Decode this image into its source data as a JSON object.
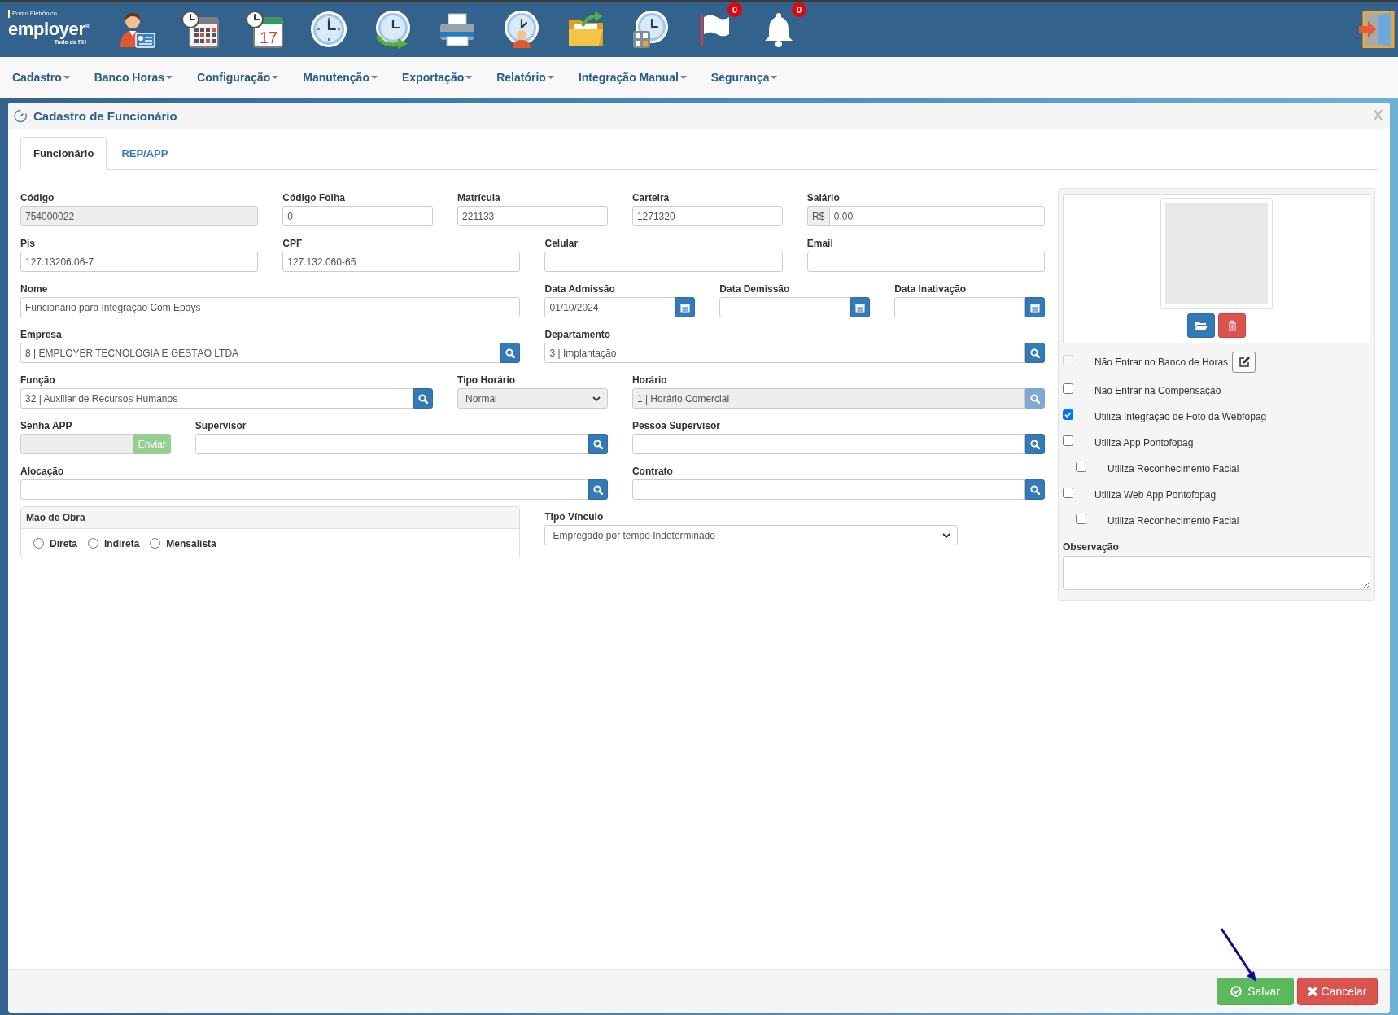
{
  "header": {
    "logo": {
      "tagline": "Ponto Eletrônico",
      "name": "employer$^{®}$",
      "slogan": "Tudo do RH"
    },
    "calendar_day": "17",
    "flag_badge": "0",
    "bell_badge": "0"
  },
  "menu": [
    "Cadastro",
    "Banco Horas",
    "Configuração",
    "Manutenção",
    "Exportação",
    "Relatório",
    "Integração Manual",
    "Segurança"
  ],
  "dialog": {
    "title": "Cadastro de Funcionário",
    "close": "X",
    "tabs": [
      {
        "label": "Funcionário",
        "selected": true
      },
      {
        "label": "REP/APP",
        "selected": false
      }
    ],
    "fields": [
      {
        "label": "Código",
        "kind": "text",
        "value": "754000022",
        "disabled": true
      },
      {
        "label": "Código Folha",
        "kind": "text",
        "value": "0",
        "disabled": false
      },
      {
        "label": "Matrícula",
        "kind": "text",
        "value": "221133",
        "disabled": false
      },
      {
        "label": "Carteira",
        "kind": "text",
        "value": "1271320",
        "disabled": false
      },
      {
        "label": "Salário",
        "kind": "money",
        "prefix": "R$",
        "value": "0,00",
        "disabled": false
      },
      {
        "label": "Pis",
        "kind": "text",
        "value": "127.13206.06-7",
        "disabled": false
      },
      {
        "label": "CPF",
        "kind": "text",
        "value": "127.132.060-65",
        "disabled": false
      },
      {
        "label": "Celular",
        "kind": "text",
        "disabled": false
      },
      {
        "label": "Email",
        "kind": "text",
        "disabled": false
      },
      {
        "label": "Nome",
        "kind": "text",
        "value": "Funcionário para Integração Com Epays",
        "disabled": false
      },
      {
        "label": "Data Admissão",
        "kind": "date",
        "value": "01/10/2024",
        "disabled": false
      },
      {
        "label": "Data Demissão",
        "kind": "date",
        "disabled": false
      },
      {
        "label": "Data Inativação",
        "kind": "date",
        "disabled": false
      },
      {
        "label": "Empresa",
        "kind": "lookup",
        "value": "8 | EMPLOYER TECNOLOGIA E GESTÃO LTDA",
        "disabled": false
      },
      {
        "label": "Departamento",
        "kind": "lookup",
        "value": "3 | Implantação",
        "disabled": false
      },
      {
        "label": "Função",
        "kind": "lookup",
        "value": "32 | Auxiliar de Recursos Humanos",
        "disabled": false
      },
      {
        "label": "Tipo Horário",
        "kind": "select",
        "value": "Normal",
        "disabled": true
      },
      {
        "label": "Horário",
        "kind": "lookup",
        "value": "1 | Horário Comercial",
        "disabled": true
      },
      {
        "label": "Senha APP",
        "kind": "password_send",
        "button": "Enviar",
        "disabled": true
      },
      {
        "label": "Supervisor",
        "kind": "lookup",
        "disabled": false
      },
      {
        "label": "Pessoa Supervisor",
        "kind": "lookup",
        "disabled": false
      },
      {
        "label": "Alocação",
        "kind": "lookup",
        "disabled": false
      },
      {
        "label": "Contrato",
        "kind": "lookup",
        "disabled": false
      },
      {
        "label": "Mão de Obra",
        "kind": "radio_group",
        "options": [
          {
            "label": "Direta",
            "selected": false
          },
          {
            "label": "Indireta",
            "selected": false
          },
          {
            "label": "Mensalista",
            "selected": false
          }
        ]
      },
      {
        "label": "Tipo Vínculo",
        "kind": "select",
        "value": "Empregado por tempo Indeterminado",
        "disabled": false
      }
    ],
    "side": {
      "checks": [
        {
          "label": "Não Entrar no Banco de Horas",
          "kind": "edit",
          "checked": false,
          "disabled": true
        },
        {
          "label": "Não Entrar na Compensação",
          "kind": "plain",
          "checked": false,
          "disabled": false
        },
        {
          "label": "Utiliza Integração de Foto da Webfopag",
          "kind": "plain",
          "checked": true,
          "disabled": false
        },
        {
          "label": "Utiliza App Pontofopag",
          "kind": "plain",
          "checked": false,
          "disabled": false,
          "children": [
            {
              "label": "Utiliza Reconhecimento Facial",
              "kind": "plain",
              "checked": false,
              "disabled": false
            }
          ]
        },
        {
          "label": "Utiliza Web App Pontofopag",
          "kind": "plain",
          "checked": false,
          "disabled": false,
          "children": [
            {
              "label": "Utiliza Reconhecimento Facial",
              "kind": "plain",
              "checked": false,
              "disabled": false
            }
          ]
        }
      ],
      "notes": {
        "label": "Observação"
      }
    },
    "buttons": [
      {
        "label": "Salvar",
        "kind": "save"
      },
      {
        "label": "Cancelar",
        "kind": "cancel"
      }
    ]
  }
}
